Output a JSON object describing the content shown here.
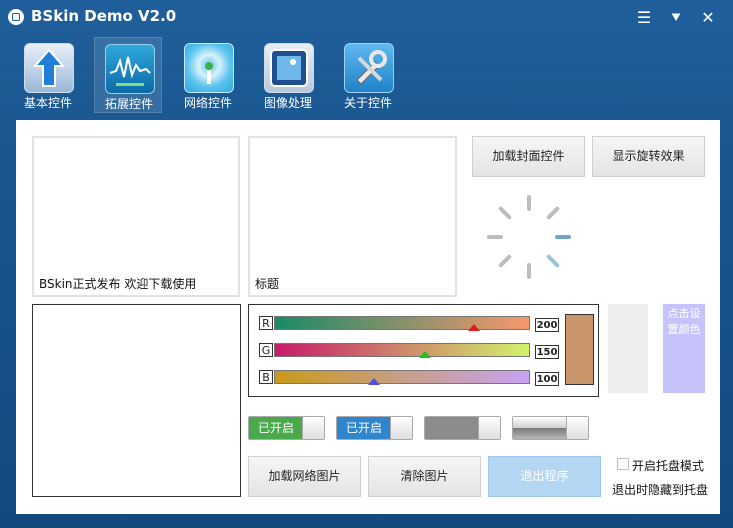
{
  "title": "BSkin Demo V2.0",
  "window_controls": {
    "menu": "☰",
    "minimize": "⯆",
    "close": "✕"
  },
  "toolbar": {
    "items": [
      {
        "label": "基本控件",
        "icon": "upload-arrow-icon"
      },
      {
        "label": "拓展控件",
        "icon": "waveform-icon"
      },
      {
        "label": "网络控件",
        "icon": "wifi-signal-icon"
      },
      {
        "label": "图像处理",
        "icon": "image-frame-icon"
      },
      {
        "label": "关于控件",
        "icon": "tools-icon"
      }
    ],
    "active_index": 1
  },
  "main": {
    "panel1_caption": "BSkin正式发布 欢迎下载使用",
    "panel2_caption": "标题",
    "btn_load_cover": "加载封面控件",
    "btn_show_rotate": "显示旋转效果",
    "sliders": [
      {
        "channel": "R",
        "value": "200",
        "start": "#1a8a68",
        "end": "#f6986e",
        "thumb": "#e02020",
        "fraction": 0.78
      },
      {
        "channel": "G",
        "value": "150",
        "start": "#c81a6a",
        "end": "#d2f36a",
        "thumb": "#22c022",
        "fraction": 0.59
      },
      {
        "channel": "B",
        "value": "100",
        "start": "#c89a1a",
        "end": "#c8a2f2",
        "thumb": "#5050e0",
        "fraction": 0.39
      }
    ],
    "swatch_color": "#c8966a",
    "color_button_label": "点击设置颜色",
    "toggles": [
      {
        "label": "已开启",
        "color": "#4aa94a"
      },
      {
        "label": "已开启",
        "color": "#2f86cc"
      },
      {
        "label": "",
        "color": "#8c8c8c"
      },
      {
        "label": "",
        "color": "#8c8c8c"
      }
    ],
    "btn_load_net_image": "加载网络图片",
    "btn_clear_image": "清除图片",
    "btn_exit": "退出程序",
    "tray_mode_label": "开启托盘模式",
    "tray_hint": "退出时隐藏到托盘"
  }
}
